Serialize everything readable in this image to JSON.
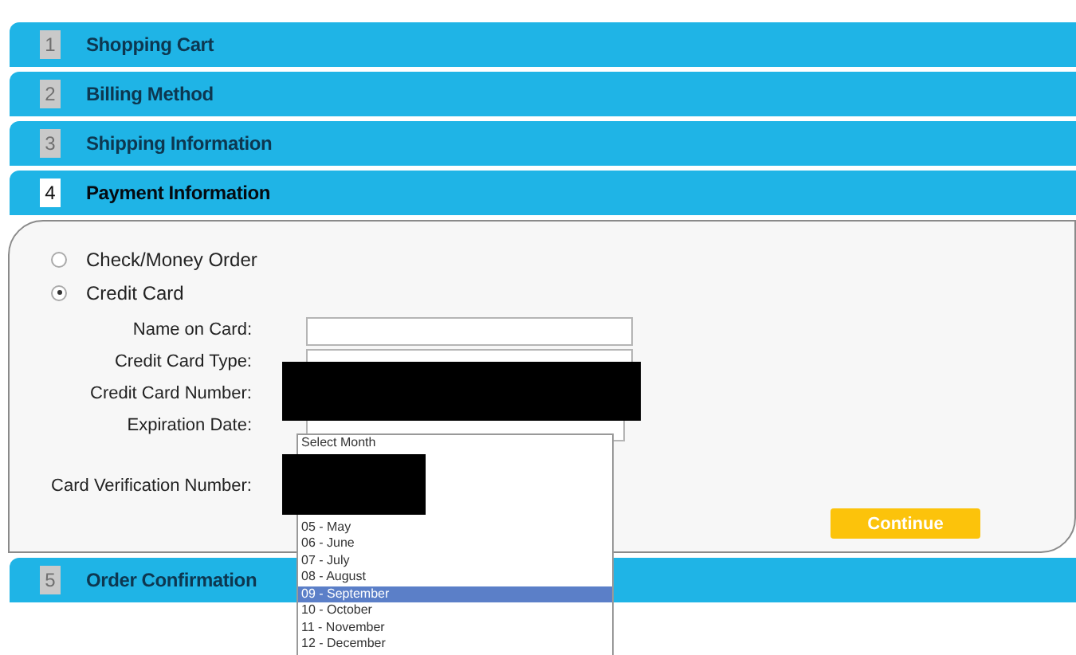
{
  "steps_before": [
    {
      "number": "1",
      "label": "Shopping Cart",
      "active": false
    },
    {
      "number": "2",
      "label": "Billing Method",
      "active": false
    },
    {
      "number": "3",
      "label": "Shipping Information",
      "active": false
    },
    {
      "number": "4",
      "label": "Payment Information",
      "active": true
    }
  ],
  "payment_methods": [
    {
      "label": "Check/Money Order",
      "selected": false
    },
    {
      "label": "Credit Card",
      "selected": true
    }
  ],
  "form": {
    "name_on_card": {
      "label": "Name on Card:"
    },
    "card_type": {
      "label": "Credit Card Type:"
    },
    "card_number": {
      "label": "Credit Card Number:"
    },
    "expiration": {
      "label": "Expiration Date:"
    },
    "cvv": {
      "label": "Card Verification Number:"
    }
  },
  "continue_button": "Continue",
  "steps_after": [
    {
      "number": "5",
      "label": "Order Confirmation",
      "active": false
    }
  ],
  "month_list": {
    "header": "Select Month",
    "options": [
      {
        "label": "05 - May",
        "selected": false
      },
      {
        "label": "06 - June",
        "selected": false
      },
      {
        "label": "07 - July",
        "selected": false
      },
      {
        "label": "08 - August",
        "selected": false
      },
      {
        "label": "09 - September",
        "selected": true
      },
      {
        "label": "10 - October",
        "selected": false
      },
      {
        "label": "11 - November",
        "selected": false
      },
      {
        "label": "12 - December",
        "selected": false
      }
    ]
  }
}
